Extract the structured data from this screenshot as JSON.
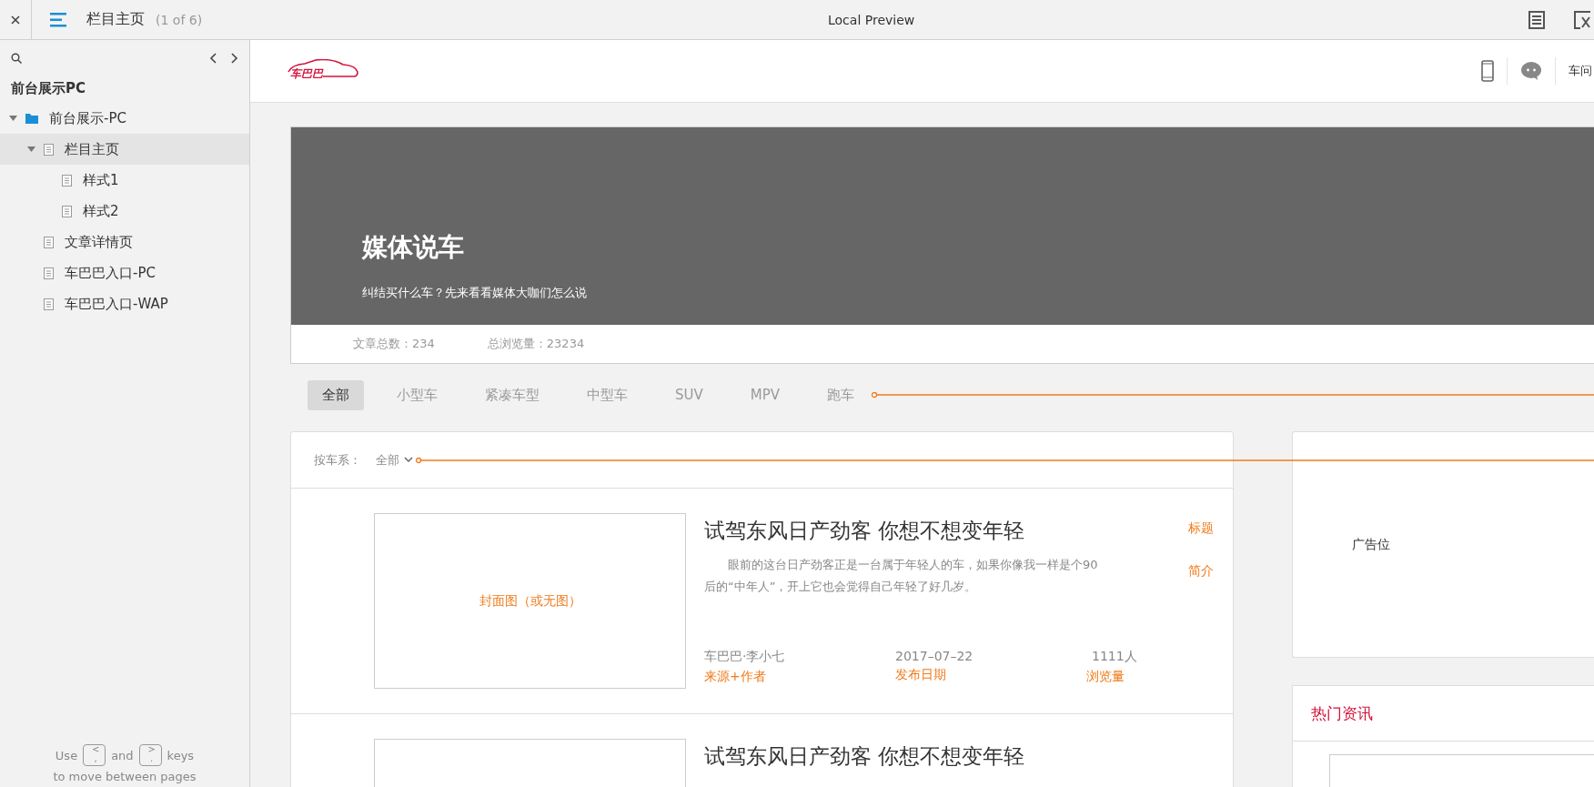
{
  "toolbar": {
    "title": "栏目主页",
    "page_count": "(1 of 6)",
    "center_title": "Local Preview"
  },
  "sidebar": {
    "heading": "前台展示PC",
    "tree": [
      {
        "label": "前台展示-PC",
        "kind": "folder",
        "expanded": true,
        "selected": false,
        "children": [
          {
            "label": "栏目主页",
            "kind": "page",
            "expanded": true,
            "selected": true,
            "children": [
              {
                "label": "样式1",
                "kind": "page",
                "selected": false
              },
              {
                "label": "样式2",
                "kind": "page",
                "selected": false
              }
            ]
          },
          {
            "label": "文章详情页",
            "kind": "page",
            "selected": false
          },
          {
            "label": "车巴巴入口-PC",
            "kind": "page",
            "selected": false
          },
          {
            "label": "车巴巴入口-WAP",
            "kind": "page",
            "selected": false
          }
        ]
      }
    ],
    "hint": {
      "use": "Use",
      "key1_top": "<",
      "key1_bottom": ",",
      "and": "and",
      "key2_top": ">",
      "key2_bottom": ".",
      "keys": "keys",
      "line2": "to move between pages"
    }
  },
  "site": {
    "logo": "车巴巴",
    "nav_text": "车问",
    "banner": {
      "title": "媒体说车",
      "subtitle": "纠结买什么车？先来看看媒体大咖们怎么说"
    },
    "stats": [
      "文章总数：234",
      "总浏览量：23234"
    ],
    "categories": [
      {
        "label": "全部",
        "selected": true
      },
      {
        "label": "小型车",
        "selected": false
      },
      {
        "label": "紧凑车型",
        "selected": false
      },
      {
        "label": "中型车",
        "selected": false
      },
      {
        "label": "SUV",
        "selected": false
      },
      {
        "label": "MPV",
        "selected": false
      },
      {
        "label": "跑车",
        "selected": false
      }
    ],
    "filter": {
      "label": "按车系：",
      "value": "全部"
    },
    "articles": [
      {
        "cover": "封面图（或无图）",
        "title": "试驾东风日产劲客 你想不想变年轻",
        "summary": "眼前的这台日产劲客正是一台属于年轻人的车，如果你像我一样是个90后的“中年人”，开上它也会觉得自己年轻了好几岁。",
        "source": "车巴巴·李小七",
        "date": "2017–07–22",
        "views": "1111人",
        "notes": {
          "title": "标题",
          "summary": "简介",
          "source": "来源+作者",
          "date": "发布日期",
          "views": "浏览量"
        }
      },
      {
        "title": "试驾东风日产劲客 你想不想变年轻"
      }
    ],
    "ad": "广告位",
    "hot_news": "热门资讯"
  }
}
